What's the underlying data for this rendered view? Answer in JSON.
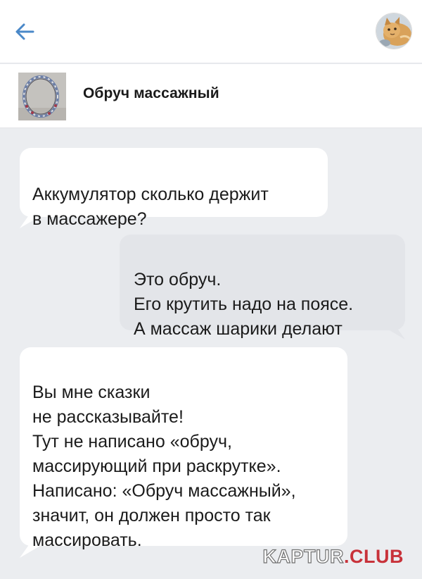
{
  "header": {
    "back_icon": "arrow-left-icon",
    "avatar_icon": "cat-avatar-icon"
  },
  "product": {
    "title": "Обруч массажный",
    "thumbnail_icon": "hula-hoop-image"
  },
  "messages": [
    {
      "side": "incoming",
      "text": "Аккумулятор сколько держит\nв массажере?"
    },
    {
      "side": "outgoing",
      "text": "Это обруч.\nЕго крутить надо на поясе.\nА массаж шарики делают"
    },
    {
      "side": "incoming",
      "text": "Вы мне сказки\nне рассказывайте!\nТут не написано «обруч,\nмассирующий при раскрутке».\nНаписано: «Обруч массажный»,\nзначит, он должен просто так\nмассировать."
    }
  ],
  "watermark": {
    "part1": "KAPTUR",
    "part2": ".CLUB"
  },
  "colors": {
    "accent": "#4a88c8",
    "background": "#ebedf0",
    "incoming_bubble": "#ffffff",
    "outgoing_bubble": "#e3e5e9",
    "watermark_red": "#c8323a"
  }
}
